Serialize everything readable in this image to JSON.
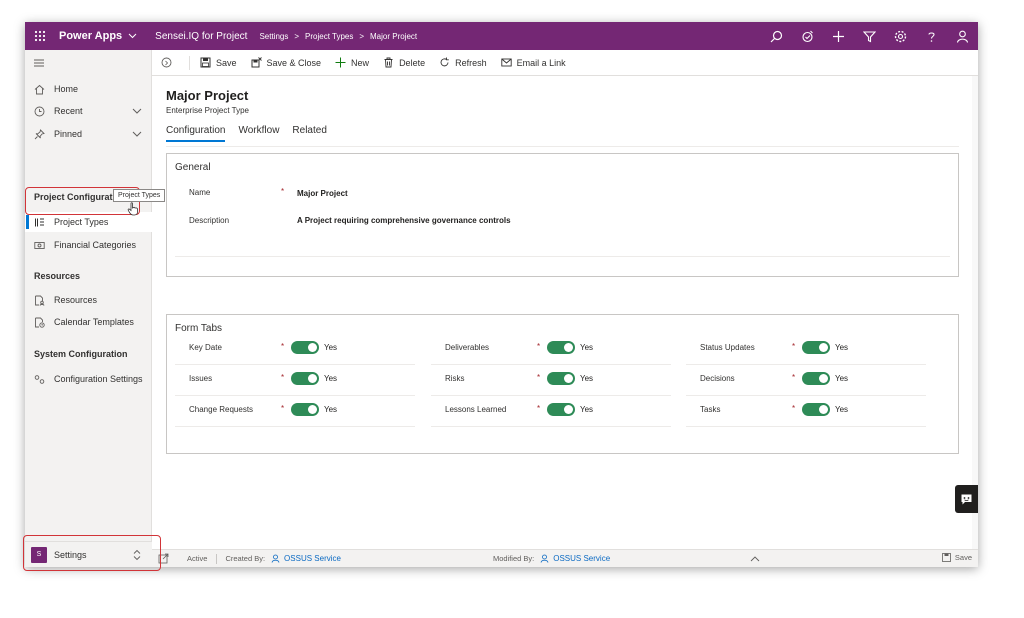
{
  "topbar": {
    "app_name": "Power Apps",
    "app_module": "Sensei.IQ for Project",
    "breadcrumb": [
      "Settings",
      "Project Types",
      "Major Project"
    ],
    "icons": [
      "search-icon",
      "assist-icon",
      "add-icon",
      "filter-icon",
      "gear-icon",
      "help-icon",
      "user-icon"
    ]
  },
  "sidebar": {
    "home": "Home",
    "recent": "Recent",
    "pinned": "Pinned",
    "group1": "Project Configuration",
    "project_types": "Project Types",
    "financial_categories": "Financial Categories",
    "group2": "Resources",
    "resources": "Resources",
    "calendar_templates": "Calendar Templates",
    "group3": "System Configuration",
    "configuration_settings": "Configuration Settings",
    "tooltip": "Project Types",
    "area_badge": "S",
    "area_label": "Settings"
  },
  "commands": {
    "save": "Save",
    "save_close": "Save & Close",
    "new": "New",
    "delete": "Delete",
    "refresh": "Refresh",
    "email_link": "Email a Link"
  },
  "record": {
    "title": "Major Project",
    "entity": "Enterprise Project Type",
    "tabs": [
      "Configuration",
      "Workflow",
      "Related"
    ]
  },
  "general": {
    "title": "General",
    "name_label": "Name",
    "name_value": "Major Project",
    "description_label": "Description",
    "description_value": "A Project requiring comprehensive governance controls"
  },
  "form_tabs": {
    "title": "Form Tabs",
    "toggle_text": "Yes",
    "items": [
      {
        "label": "Key Date"
      },
      {
        "label": "Deliverables"
      },
      {
        "label": "Status Updates"
      },
      {
        "label": "Issues"
      },
      {
        "label": "Risks"
      },
      {
        "label": "Decisions"
      },
      {
        "label": "Change Requests"
      },
      {
        "label": "Lessons Learned"
      },
      {
        "label": "Tasks"
      }
    ]
  },
  "footer": {
    "status": "Active",
    "created_by_label": "Created By:",
    "created_by": "OSSUS Service",
    "modified_by_label": "Modified By:",
    "modified_by": "OSSUS Service",
    "save": "Save"
  },
  "colors": {
    "brand": "#742774",
    "accent": "#0078d4",
    "toggle_on": "#2e8b57",
    "highlight": "#d13438"
  }
}
